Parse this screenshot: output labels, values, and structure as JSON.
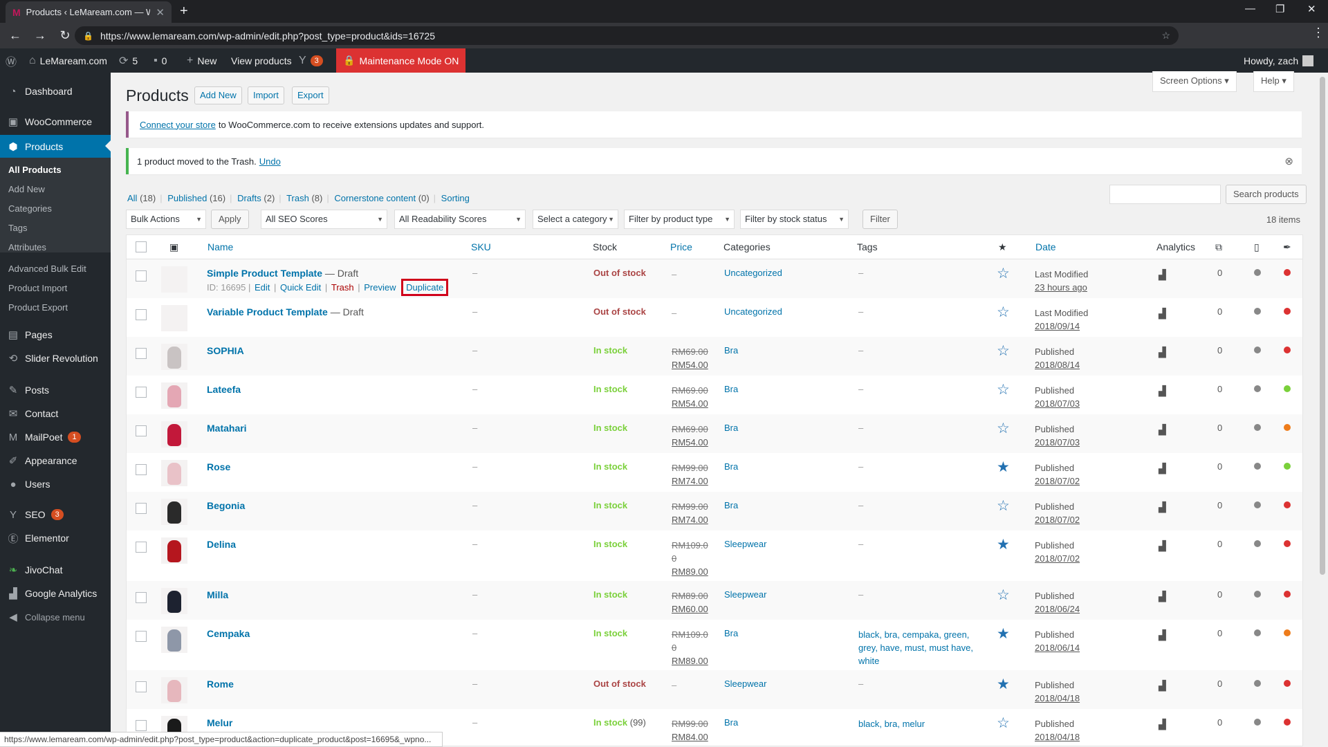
{
  "browser": {
    "tab_title": "Products ‹ LeMaream.com — Wo",
    "url": "https://www.lemaream.com/wp-admin/edit.php?post_type=product&ids=16725",
    "status_url": "https://www.lemaream.com/wp-admin/edit.php?post_type=product&action=duplicate_product&post=16695&_wpno..."
  },
  "adminbar": {
    "site": "LeMaream.com",
    "updates": "5",
    "comments": "0",
    "new": "New",
    "view": "View products",
    "yoast_count": "3",
    "maintenance": "Maintenance Mode ON",
    "howdy": "Howdy, zach"
  },
  "sidebar": {
    "dashboard": "Dashboard",
    "woocommerce": "WooCommerce",
    "products": "Products",
    "sub": [
      "All Products",
      "Add New",
      "Categories",
      "Tags",
      "Attributes",
      "Advanced Bulk Edit",
      "Product Import",
      "Product Export"
    ],
    "pages": "Pages",
    "slider": "Slider Revolution",
    "posts": "Posts",
    "contact": "Contact",
    "mailpoet": "MailPoet",
    "mailpoet_count": "1",
    "appearance": "Appearance",
    "users": "Users",
    "seo": "SEO",
    "seo_count": "3",
    "elementor": "Elementor",
    "jivochat": "JivoChat",
    "analytics": "Google Analytics",
    "collapse": "Collapse menu"
  },
  "page": {
    "title": "Products",
    "add_new": "Add New",
    "import": "Import",
    "export": "Export",
    "screen_options": "Screen Options",
    "help": "Help",
    "notice_connect_link": "Connect your store",
    "notice_connect_text": "to WooCommerce.com to receive extensions updates and support.",
    "notice_trash": "1 product moved to the Trash.",
    "notice_undo": "Undo"
  },
  "views": {
    "all": "All",
    "all_count": "(18)",
    "published": "Published",
    "published_count": "(16)",
    "drafts": "Drafts",
    "drafts_count": "(2)",
    "trash": "Trash",
    "trash_count": "(8)",
    "cornerstone": "Cornerstone content",
    "cornerstone_count": "(0)",
    "sorting": "Sorting"
  },
  "filters": {
    "bulk": "Bulk Actions",
    "apply": "Apply",
    "seo": "All SEO Scores",
    "readability": "All Readability Scores",
    "category": "Select a category",
    "type": "Filter by product type",
    "stock": "Filter by stock status",
    "filter": "Filter",
    "search_button": "Search products",
    "items": "18 items"
  },
  "columns": {
    "name": "Name",
    "sku": "SKU",
    "stock": "Stock",
    "price": "Price",
    "categories": "Categories",
    "tags": "Tags",
    "date": "Date",
    "analytics": "Analytics"
  },
  "rows": [
    {
      "name": "Simple Product Template",
      "state": "— Draft",
      "sku": "–",
      "stock": "Out of stock",
      "qty": "",
      "price_old": "–",
      "price_new": "",
      "category": "Uncategorized",
      "tags": "–",
      "featured": false,
      "date_label": "Last Modified",
      "date": "23 hours ago",
      "views": "0",
      "seo_color": "#888888",
      "read_color": "#dc3232",
      "thumb": "#eeeeee"
    },
    {
      "name": "Variable Product Template",
      "state": "— Draft",
      "sku": "–",
      "stock": "Out of stock",
      "qty": "",
      "price_old": "–",
      "price_new": "",
      "category": "Uncategorized",
      "tags": "–",
      "featured": false,
      "date_label": "Last Modified",
      "date": "2018/09/14",
      "views": "0",
      "seo_color": "#888888",
      "read_color": "#dc3232",
      "thumb": "#eeeeee"
    },
    {
      "name": "SOPHIA",
      "state": "",
      "sku": "–",
      "stock": "In stock",
      "qty": "",
      "price_old": "RM69.00",
      "price_new": "RM54.00",
      "category": "Bra",
      "tags": "–",
      "featured": false,
      "date_label": "Published",
      "date": "2018/08/14",
      "views": "0",
      "seo_color": "#888888",
      "read_color": "#dc3232",
      "thumb": "#c9c3c3"
    },
    {
      "name": "Lateefa",
      "state": "",
      "sku": "–",
      "stock": "In stock",
      "qty": "",
      "price_old": "RM69.00",
      "price_new": "RM54.00",
      "category": "Bra",
      "tags": "–",
      "featured": false,
      "date_label": "Published",
      "date": "2018/07/03",
      "views": "0",
      "seo_color": "#888888",
      "read_color": "#7ad03a",
      "thumb": "#e4a7b4"
    },
    {
      "name": "Matahari",
      "state": "",
      "sku": "–",
      "stock": "In stock",
      "qty": "",
      "price_old": "RM69.00",
      "price_new": "RM54.00",
      "category": "Bra",
      "tags": "–",
      "featured": false,
      "date_label": "Published",
      "date": "2018/07/03",
      "views": "0",
      "seo_color": "#888888",
      "read_color": "#ee7c1b",
      "thumb": "#c2183a"
    },
    {
      "name": "Rose",
      "state": "",
      "sku": "–",
      "stock": "In stock",
      "qty": "",
      "price_old": "RM99.00",
      "price_new": "RM74.00",
      "category": "Bra",
      "tags": "–",
      "featured": true,
      "date_label": "Published",
      "date": "2018/07/02",
      "views": "0",
      "seo_color": "#888888",
      "read_color": "#7ad03a",
      "thumb": "#e9c2c8"
    },
    {
      "name": "Begonia",
      "state": "",
      "sku": "–",
      "stock": "In stock",
      "qty": "",
      "price_old": "RM99.00",
      "price_new": "RM74.00",
      "category": "Bra",
      "tags": "–",
      "featured": false,
      "date_label": "Published",
      "date": "2018/07/02",
      "views": "0",
      "seo_color": "#888888",
      "read_color": "#dc3232",
      "thumb": "#2a2a2a"
    },
    {
      "name": "Delina",
      "state": "",
      "sku": "–",
      "stock": "In stock",
      "qty": "",
      "price_old": "RM109.00",
      "price_new": "RM89.00",
      "category": "Sleepwear",
      "tags": "–",
      "featured": true,
      "date_label": "Published",
      "date": "2018/07/02",
      "views": "0",
      "seo_color": "#888888",
      "read_color": "#dc3232",
      "thumb": "#b5161e"
    },
    {
      "name": "Milla",
      "state": "",
      "sku": "–",
      "stock": "In stock",
      "qty": "",
      "price_old": "RM89.00",
      "price_new": "RM60.00",
      "category": "Sleepwear",
      "tags": "–",
      "featured": false,
      "date_label": "Published",
      "date": "2018/06/24",
      "views": "0",
      "seo_color": "#888888",
      "read_color": "#dc3232",
      "thumb": "#1d2230"
    },
    {
      "name": "Cempaka",
      "state": "",
      "sku": "–",
      "stock": "In stock",
      "qty": "",
      "price_old": "RM109.00",
      "price_new": "RM89.00",
      "category": "Bra",
      "tags": "black, bra, cempaka, green, grey, have, must, must have, white",
      "featured": true,
      "date_label": "Published",
      "date": "2018/06/14",
      "views": "0",
      "seo_color": "#888888",
      "read_color": "#ee7c1b",
      "thumb": "#8e97a8"
    },
    {
      "name": "Rome",
      "state": "",
      "sku": "–",
      "stock": "Out of stock",
      "qty": "",
      "price_old": "–",
      "price_new": "",
      "category": "Sleepwear",
      "tags": "–",
      "featured": true,
      "date_label": "Published",
      "date": "2018/04/18",
      "views": "0",
      "seo_color": "#888888",
      "read_color": "#dc3232",
      "thumb": "#e6b7bd"
    },
    {
      "name": "Melur",
      "state": "",
      "sku": "–",
      "stock": "In stock",
      "qty": "(99)",
      "price_old": "RM99.00",
      "price_new": "RM84.00",
      "category": "Bra",
      "tags": "black, bra, melur",
      "featured": false,
      "date_label": "Published",
      "date": "2018/04/18",
      "views": "0",
      "seo_color": "#888888",
      "read_color": "#dc3232",
      "thumb": "#1a1a1a"
    }
  ],
  "row_actions": {
    "id": "ID: 16695",
    "edit": "Edit",
    "quick_edit": "Quick Edit",
    "trash": "Trash",
    "preview": "Preview",
    "duplicate": "Duplicate"
  }
}
